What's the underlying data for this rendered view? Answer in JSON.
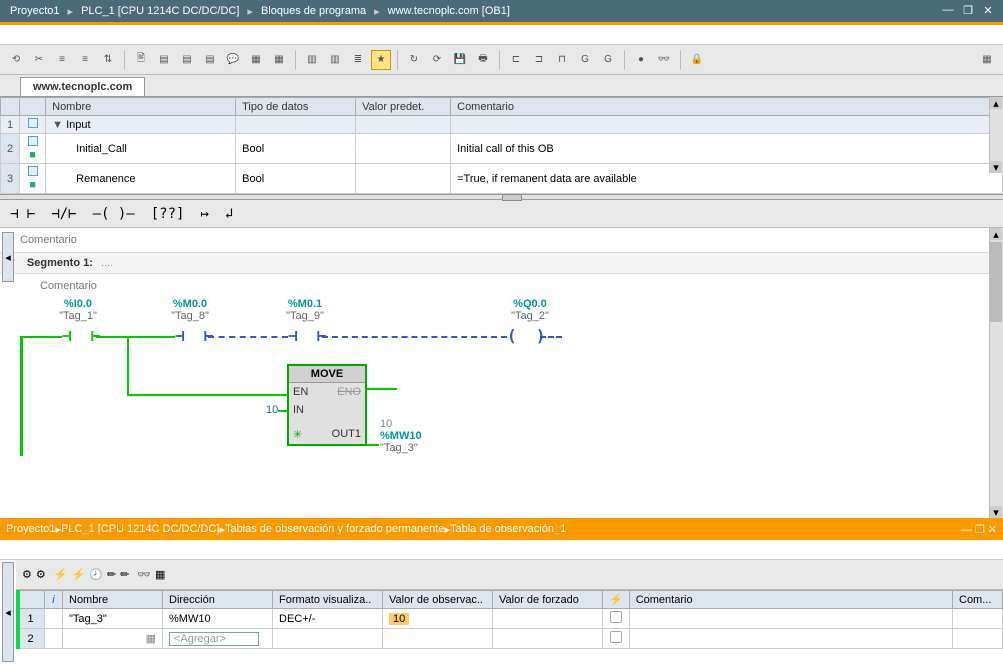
{
  "topbar": {
    "crumbs": [
      "Proyecto1",
      "PLC_1 [CPU 1214C DC/DC/DC]",
      "Bloques de programa",
      "www.tecnoplc.com [OB1]"
    ]
  },
  "tab": {
    "title": "www.tecnoplc.com"
  },
  "var_headers": {
    "name": "Nombre",
    "type": "Tipo de datos",
    "default": "Valor predet.",
    "comment": "Comentario"
  },
  "var_rows": {
    "section": "Input",
    "r1": {
      "name": "Initial_Call",
      "type": "Bool",
      "default": "",
      "comment": "Initial call of this OB"
    },
    "r2": {
      "name": "Remanence",
      "type": "Bool",
      "default": "",
      "comment": "=True, if remanent data are available"
    }
  },
  "editor": {
    "comentario": "Comentario",
    "segment_label": "Segmento 1:",
    "segment_dots": "....",
    "tags": {
      "i00": {
        "addr": "%I0.0",
        "name": "\"Tag_1\""
      },
      "m00": {
        "addr": "%M0.0",
        "name": "\"Tag_8\""
      },
      "m01": {
        "addr": "%M0.1",
        "name": "\"Tag_9\""
      },
      "q00": {
        "addr": "%Q0.0",
        "name": "\"Tag_2\""
      },
      "mw10": {
        "val": "10",
        "addr": "%MW10",
        "name": "\"Tag_3\""
      }
    },
    "move": {
      "title": "MOVE",
      "en": "EN",
      "eno": "ENO",
      "in": "IN",
      "out1": "OUT1",
      "in_val": "10"
    }
  },
  "watchbar": {
    "crumbs": [
      "Proyecto1",
      "PLC_1 [CPU 1214C DC/DC/DC]",
      "Tablas de observación y forzado permanente",
      "Tabla de observación_1"
    ]
  },
  "watch_headers": {
    "i": "i",
    "name": "Nombre",
    "addr": "Dirección",
    "fmt": "Formato visualiza..",
    "obs": "Valor de observac..",
    "force": "Valor de forzado",
    "bolt": "⚡",
    "comment": "Comentario",
    "comend": "Com..."
  },
  "watch_rows": {
    "r1": {
      "name": "\"Tag_3\"",
      "addr": "%MW10",
      "fmt": "DEC+/-",
      "obs": "10",
      "force": ""
    },
    "add_placeholder": "<Agregar>"
  }
}
